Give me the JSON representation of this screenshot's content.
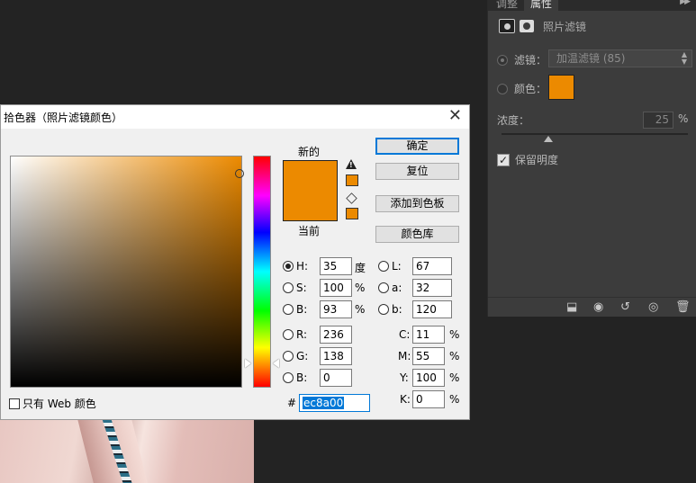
{
  "panel": {
    "tabs": [
      "调整",
      "属性"
    ],
    "collapse_icon": "double-chevron-right-icon",
    "header_title": "照片滤镜",
    "filter_label": "滤镜：",
    "filter_value": "加温滤镜 (85)",
    "color_label": "颜色：",
    "color_value": "#ec8a00",
    "density_label": "浓度：",
    "density_value": "25",
    "density_unit": "%",
    "density_level": 0.25,
    "preserve_label": "保留明度",
    "preserve_checked": true,
    "footer_icons": [
      "clip-to-layer-icon",
      "view-previous-icon",
      "reset-icon",
      "visibility-eye-icon",
      "trash-icon"
    ]
  },
  "dialog": {
    "title": "拾色器（照片滤镜颜色）",
    "close_glyph": "✕",
    "new_label": "新的",
    "current_label": "当前",
    "new_color": "#ec8a00",
    "current_color": "#ec8a00",
    "buttons": {
      "ok": "确定",
      "reset": "复位",
      "add_swatch": "添加到色板",
      "libraries": "颜色库"
    },
    "hsb": {
      "h_label": "H:",
      "h_value": "35",
      "h_unit": "度",
      "s_label": "S:",
      "s_value": "100",
      "s_unit": "%",
      "b_label": "B:",
      "b_value": "93",
      "b_unit": "%"
    },
    "lab": {
      "l_label": "L:",
      "l_value": "67",
      "a_label": "a:",
      "a_value": "32",
      "b_label": "b:",
      "b_value": "120"
    },
    "rgb": {
      "r_label": "R:",
      "r_value": "236",
      "g_label": "G:",
      "g_value": "138",
      "b_label": "B:",
      "b_value": "0"
    },
    "cmyk": {
      "c_label": "C:",
      "c_value": "11",
      "c_unit": "%",
      "m_label": "M:",
      "m_value": "55",
      "m_unit": "%",
      "y_label": "Y:",
      "y_value": "100",
      "y_unit": "%",
      "k_label": "K:",
      "k_value": "0",
      "k_unit": "%"
    },
    "web_only_label": "只有 Web 颜色",
    "hex_label": "#",
    "hex_value": "ec8a00"
  }
}
